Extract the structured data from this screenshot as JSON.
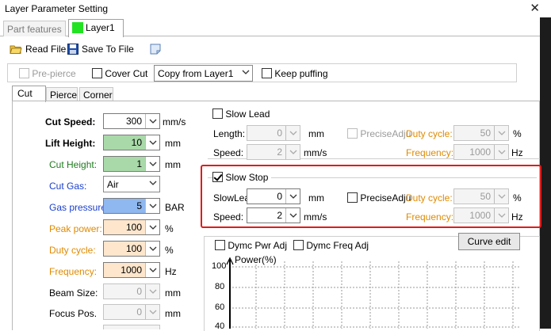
{
  "window": {
    "title": "Layer Parameter Setting",
    "close": "✕"
  },
  "tabs": {
    "part_features": "Part features",
    "layer": "Layer1",
    "layer_color": "#22e322"
  },
  "toolbar": {
    "read_file": "Read File",
    "save_to_file": "Save To File"
  },
  "options": {
    "pre_pierce": "Pre-pierce",
    "cover_cut": "Cover Cut",
    "copy_from": "Copy from Layer1",
    "keep_puffing": "Keep puffing"
  },
  "subtabs": {
    "cut": "Cut",
    "pierce": "Pierce",
    "corner": "Corner"
  },
  "cut": {
    "cut_speed": {
      "label": "Cut Speed:",
      "value": "300",
      "unit": "mm/s"
    },
    "lift_height": {
      "label": "Lift Height:",
      "value": "10",
      "unit": "mm"
    },
    "cut_height": {
      "label": "Cut Height:",
      "value": "1",
      "unit": "mm"
    },
    "cut_gas": {
      "label": "Cut Gas:",
      "value": "Air"
    },
    "gas_pressure": {
      "label": "Gas pressure",
      "value": "5",
      "unit": "BAR"
    },
    "peak_power": {
      "label": "Peak power:",
      "value": "100",
      "unit": "%"
    },
    "duty_cycle": {
      "label": "Duty cycle:",
      "value": "100",
      "unit": "%"
    },
    "frequency": {
      "label": "Frequency:",
      "value": "1000",
      "unit": "Hz"
    },
    "beam_size": {
      "label": "Beam Size:",
      "value": "0",
      "unit": "mm"
    },
    "focus_pos": {
      "label": "Focus Pos.",
      "value": "0",
      "unit": "mm"
    }
  },
  "slow_lead": {
    "title": "Slow Lead",
    "length_label": "Length:",
    "length_value": "0",
    "length_unit": "mm",
    "speed_label": "Speed:",
    "speed_value": "2",
    "speed_unit": "mm/s",
    "precise_adj": "PreciseAdju",
    "duty_label": "Duty cycle:",
    "duty_value": "50",
    "duty_unit": "%",
    "freq_label": "Frequency:",
    "freq_value": "1000",
    "freq_unit": "Hz"
  },
  "slow_stop": {
    "title": "Slow Stop",
    "length_label": "SlowLead",
    "length_value": "0",
    "length_unit": "mm",
    "speed_label": "Speed:",
    "speed_value": "2",
    "speed_unit": "mm/s",
    "precise_adj": "PreciseAdju",
    "duty_label": "Duty cycle:",
    "duty_value": "50",
    "duty_unit": "%",
    "freq_label": "Frequency:",
    "freq_value": "1000",
    "freq_unit": "Hz"
  },
  "power_curve": {
    "dymc_pwr": "Dymc Pwr Adj",
    "dymc_freq": "Dymc Freq Adj",
    "curve_edit": "Curve edit",
    "y_axis_label": "Power(%)",
    "y_ticks": [
      "100",
      "80",
      "60",
      "40"
    ]
  },
  "colors": {
    "highlight_red": "#e01b1b",
    "green_field": "#a9d9a9",
    "blue_field": "#8fb8f0",
    "orange_field": "#fde6cc"
  }
}
